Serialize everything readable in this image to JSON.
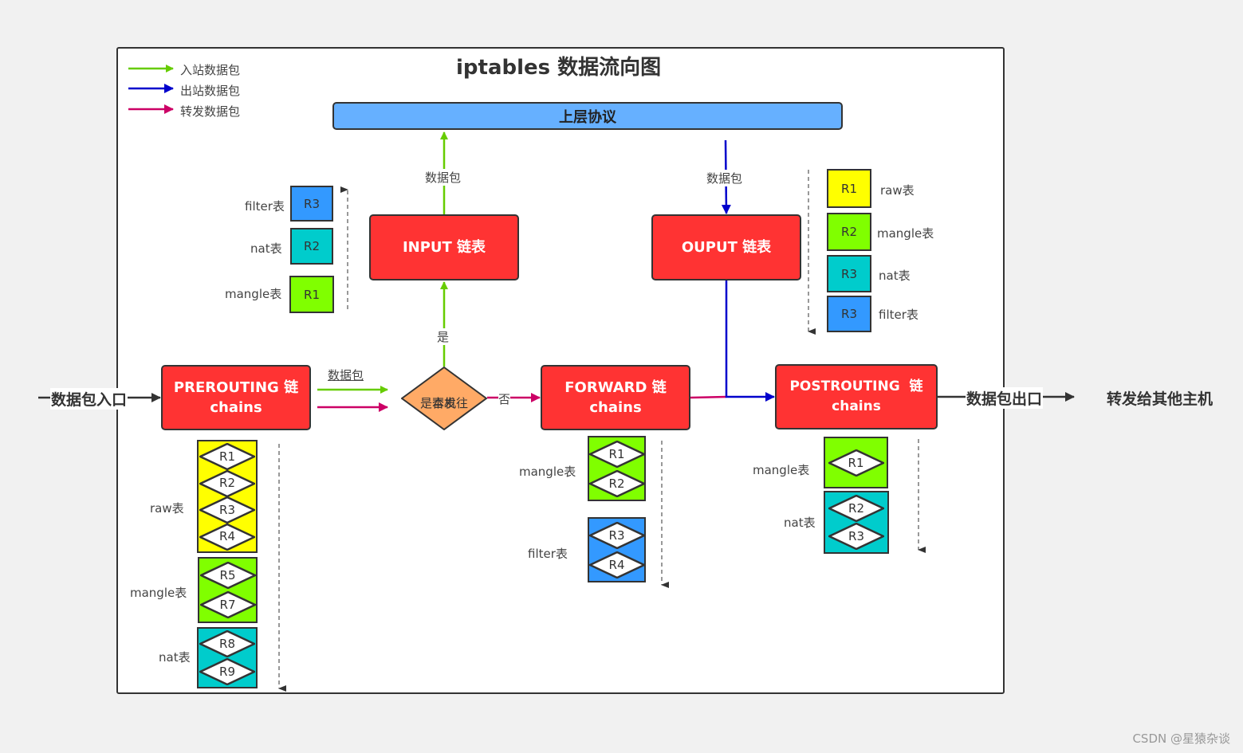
{
  "title": "iptables 数据流向图",
  "legend": [
    {
      "label": "入站数据包",
      "color": "#66cc00"
    },
    {
      "label": "出站数据包",
      "color": "#0000cc"
    },
    {
      "label": "转发数据包",
      "color": "#cc0066"
    }
  ],
  "upper_protocol": "上层协议",
  "colors": {
    "chain_fill": "#ff3333",
    "raw": "#ffff00",
    "mangle": "#80ff00",
    "nat": "#00cccc",
    "filter": "#3399ff",
    "decision_fill": "#ffaa66",
    "protocol_fill": "#66b0ff"
  },
  "chains": {
    "prerouting": {
      "line1": "PREROUTING 链",
      "line2": "chains"
    },
    "input": {
      "line1": "INPUT 链表"
    },
    "output": {
      "line1": "OUPUT 链表"
    },
    "forward": {
      "line1": "FORWARD 链",
      "line2": "chains"
    },
    "postrouting": {
      "line1": "POSTROUTING  链",
      "line2": "chains"
    }
  },
  "decision": {
    "line1": "是否发往",
    "line2": "本机",
    "yes": "是",
    "no": "否"
  },
  "edge_labels": {
    "packet_in_left": "数据包",
    "packet_input_up": "数据包",
    "packet_output_down": "数据包"
  },
  "entry": "数据包入口",
  "exit": "数据包出口",
  "forward_to": "转发给其他主机",
  "input_tables": [
    {
      "table": "filter表",
      "rule": "R3",
      "type": "filter"
    },
    {
      "table": "nat表",
      "rule": "R2",
      "type": "nat"
    },
    {
      "table": "mangle表",
      "rule": "R1",
      "type": "mangle"
    }
  ],
  "output_tables": [
    {
      "table": "raw表",
      "rule": "R1",
      "type": "raw"
    },
    {
      "table": "mangle表",
      "rule": "R2",
      "type": "mangle"
    },
    {
      "table": "nat表",
      "rule": "R3",
      "type": "nat"
    },
    {
      "table": "filter表",
      "rule": "R3",
      "type": "filter"
    }
  ],
  "prerouting_tables": [
    {
      "table": "raw表",
      "rules": [
        "R1",
        "R2",
        "R3",
        "R4"
      ],
      "type": "raw"
    },
    {
      "table": "mangle表",
      "rules": [
        "R5",
        "R7"
      ],
      "type": "mangle"
    },
    {
      "table": "nat表",
      "rules": [
        "R8",
        "R9"
      ],
      "type": "nat"
    }
  ],
  "forward_tables": [
    {
      "table": "mangle表",
      "rules": [
        "R1",
        "R2"
      ],
      "type": "mangle"
    },
    {
      "table": "filter表",
      "rules": [
        "R3",
        "R4"
      ],
      "type": "filter"
    }
  ],
  "postrouting_tables": [
    {
      "table": "mangle表",
      "rules": [
        "R1"
      ],
      "type": "mangle"
    },
    {
      "table": "nat表",
      "rules": [
        "R2",
        "R3"
      ],
      "type": "nat"
    }
  ],
  "watermark": "CSDN @星猿杂谈"
}
